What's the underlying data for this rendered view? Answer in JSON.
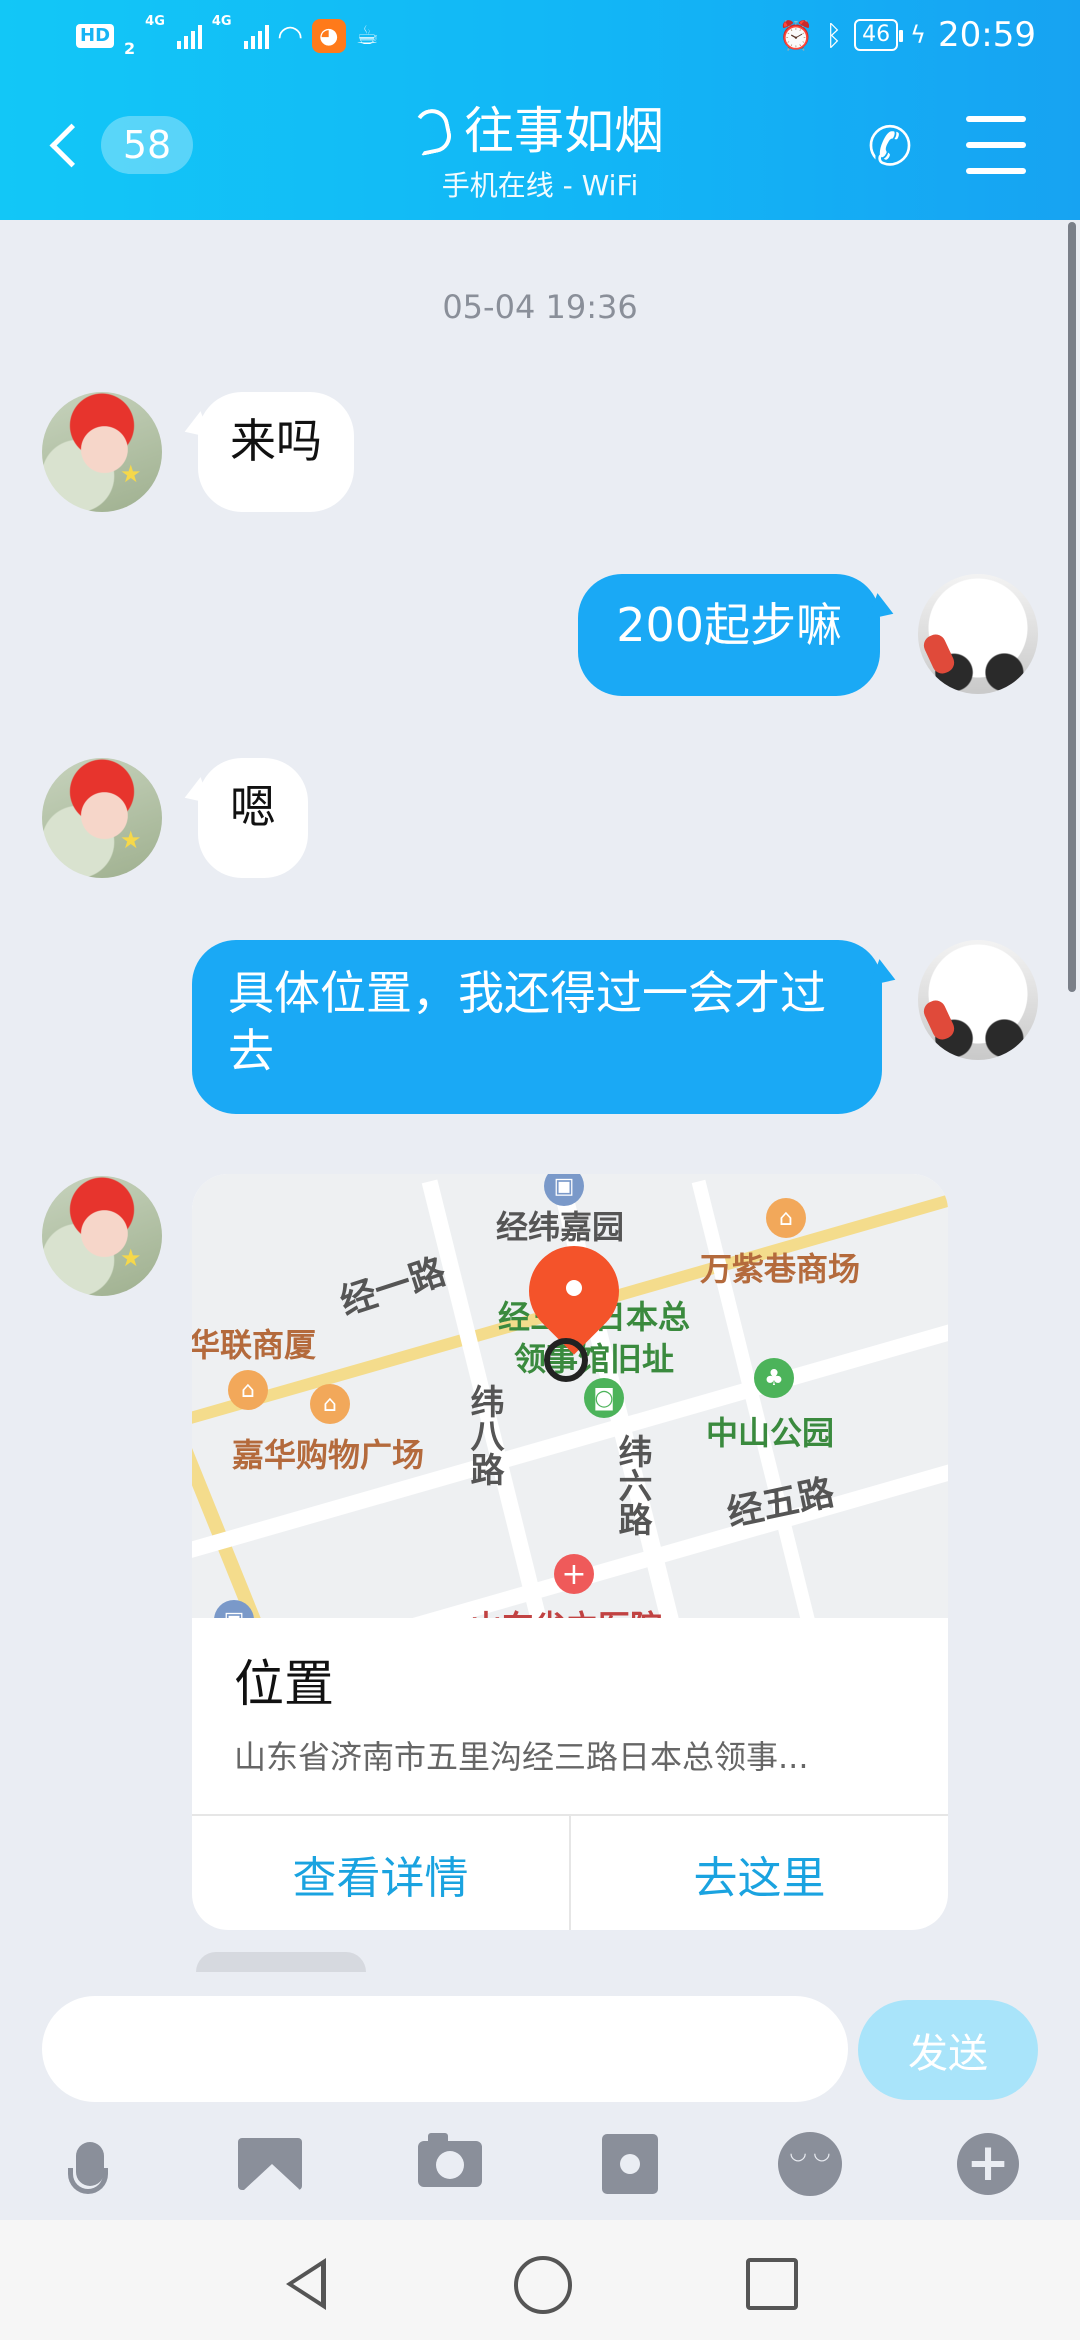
{
  "status_bar": {
    "hd_label": "HD",
    "sim_index": "2",
    "net1": "4G",
    "net2": "4G",
    "battery": "46",
    "time": "20:59"
  },
  "header": {
    "unread_count": "58",
    "contact_name": "往事如烟",
    "contact_status": "手机在线 - WiFi"
  },
  "chat": {
    "timestamp": "05-04 19:36",
    "messages": [
      {
        "from": "other",
        "text": "来吗"
      },
      {
        "from": "self",
        "text": "200起步嘛"
      },
      {
        "from": "other",
        "text": "嗯"
      },
      {
        "from": "self",
        "text": "具体位置，我还得过一会才过去"
      }
    ],
    "location_card": {
      "title": "位置",
      "address": "山东省济南市五里沟经三路日本总领事...",
      "action_details": "查看详情",
      "action_navigate": "去这里",
      "map_labels": {
        "jingwei_garden": "经纬嘉园",
        "wanzixiang": "万紫巷商场",
        "jingyi_road": "经一路",
        "consulate_line1": "经三路日本总",
        "consulate_line2": "领事馆旧址",
        "hualian": "华联商厦",
        "jiahua": "嘉华购物广场",
        "weiba_road": "纬八路",
        "weiliu_road": "纬六路",
        "zhongshan_park": "中山公园",
        "jingwu_road": "经五路",
        "hospital": "山东省立医院"
      }
    }
  },
  "input": {
    "placeholder": "",
    "send_label": "发送"
  },
  "toolbar_icons": [
    "microphone-icon",
    "image-icon",
    "camera-icon",
    "red-envelope-icon",
    "emoji-icon",
    "plus-icon"
  ],
  "colors": {
    "header_blue": "#12b6f6",
    "outgoing_bubble": "#1aa9f5",
    "map_pin": "#f4532a",
    "action_link": "#1aa3e0"
  }
}
